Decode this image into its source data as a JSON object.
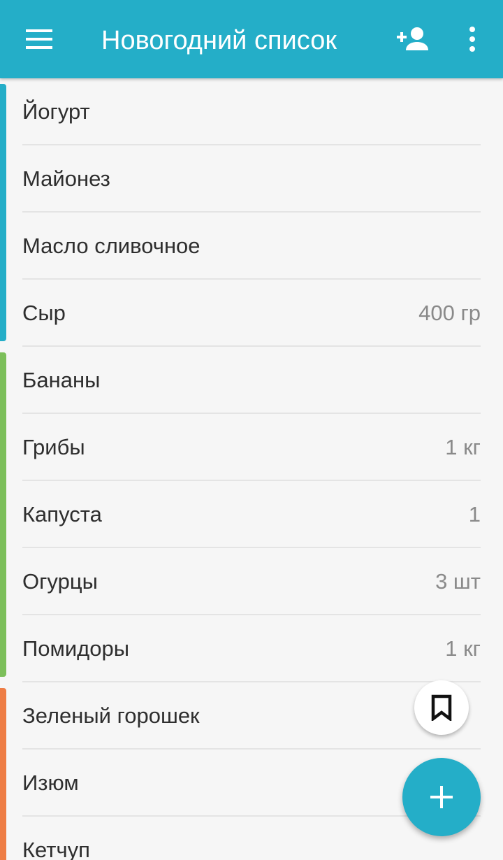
{
  "header": {
    "title": "Новогодний список",
    "menu_icon": "hamburger-menu-icon",
    "add_user_icon": "person-add-icon",
    "more_icon": "more-vertical-icon"
  },
  "colors": {
    "primary": "#24aec8",
    "group_blue": "#24aec8",
    "group_green": "#7cbf5a",
    "group_orange": "#ee7d45"
  },
  "list": {
    "items": [
      {
        "name": "Йогурт",
        "qty": ""
      },
      {
        "name": "Майонез",
        "qty": ""
      },
      {
        "name": "Масло сливочное",
        "qty": ""
      },
      {
        "name": "Сыр",
        "qty": "400 гр"
      },
      {
        "name": "Бананы",
        "qty": ""
      },
      {
        "name": "Грибы",
        "qty": "1 кг"
      },
      {
        "name": "Капуста",
        "qty": "1"
      },
      {
        "name": "Огурцы",
        "qty": "3 шт"
      },
      {
        "name": "Помидоры",
        "qty": "1 кг"
      },
      {
        "name": "Зеленый горошек",
        "qty": ""
      },
      {
        "name": "Изюм",
        "qty": ""
      },
      {
        "name": "Кетчуп",
        "qty": ""
      }
    ]
  },
  "fabs": {
    "bookmark_icon": "bookmark-icon",
    "add_icon": "plus-icon"
  }
}
